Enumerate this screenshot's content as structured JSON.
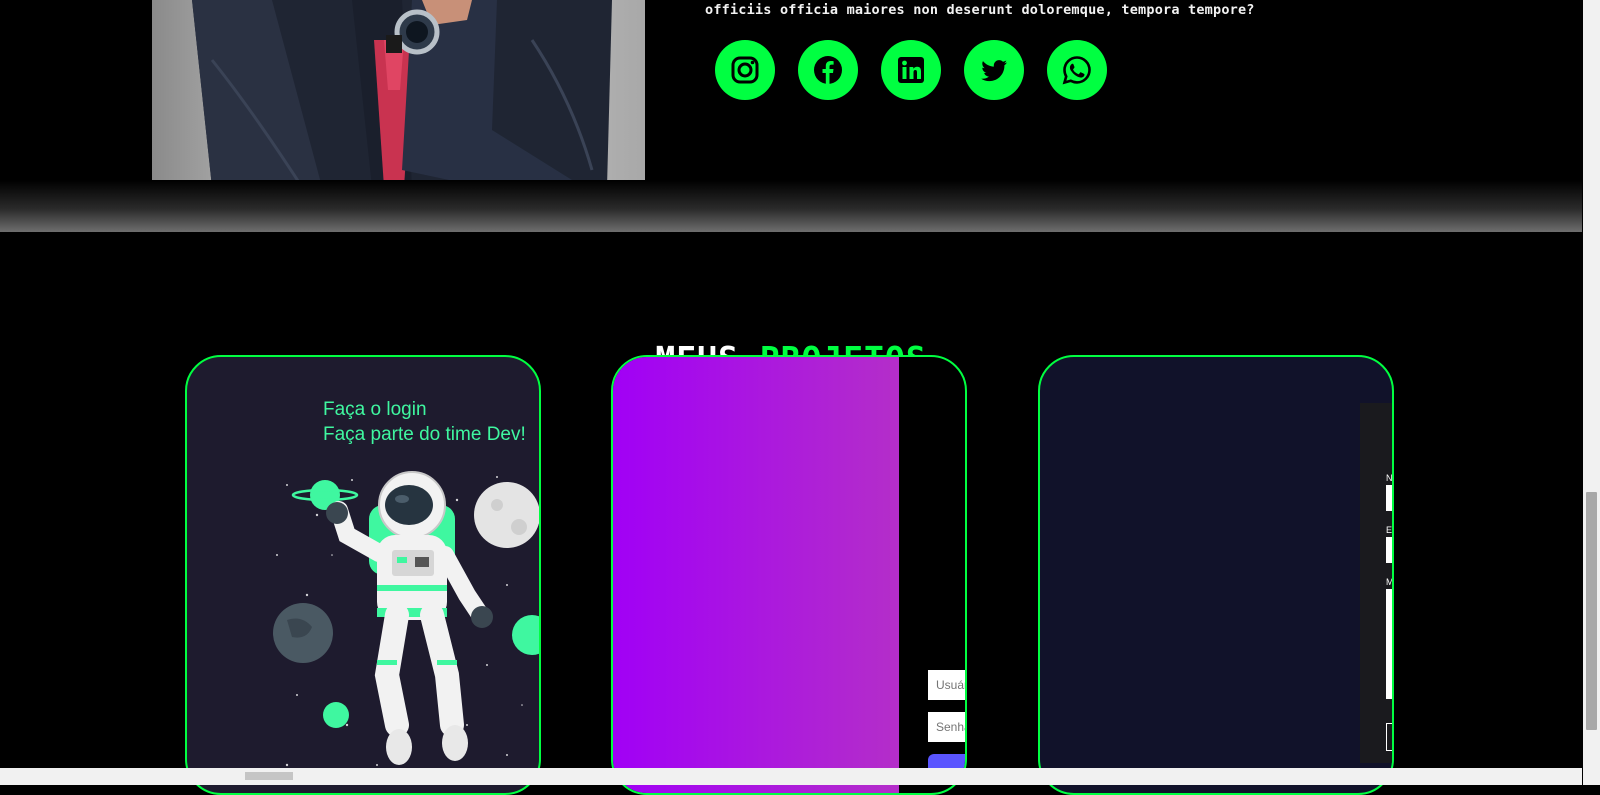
{
  "about": {
    "text": "officiis officia maiores non deserunt doloremque, tempora tempore?",
    "socials": [
      {
        "name": "instagram"
      },
      {
        "name": "facebook"
      },
      {
        "name": "linkedin"
      },
      {
        "name": "twitter"
      },
      {
        "name": "whatsapp"
      }
    ]
  },
  "projects": {
    "title_white": "MEUS",
    "title_green": "PROJETOS",
    "card1": {
      "line1": "Faça o login",
      "line2": "Faça parte do time Dev!"
    },
    "card2": {
      "user_placeholder": "Usuário",
      "pass_placeholder": "Senha"
    },
    "card3": {
      "label_name": "No",
      "label_email": "Em",
      "label_msg": "Me"
    }
  },
  "colors": {
    "accent": "#00ff41",
    "card1_bg": "#1e1b2e",
    "card3_bg": "#11122a"
  }
}
